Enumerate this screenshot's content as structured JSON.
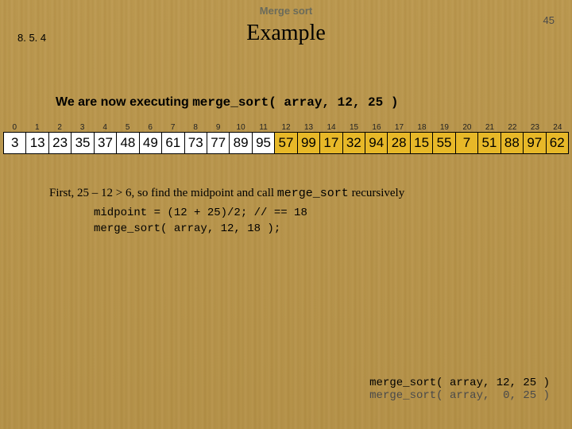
{
  "header": {
    "title": "Merge sort",
    "page_number": "45"
  },
  "section": {
    "number": "8. 5. 4",
    "title": "Example"
  },
  "intro": {
    "prefix": "We are now executing ",
    "code": "merge_sort( array, 12, 25 )"
  },
  "array": {
    "indices": [
      "0",
      "1",
      "2",
      "3",
      "4",
      "5",
      "6",
      "7",
      "8",
      "9",
      "10",
      "11",
      "12",
      "13",
      "14",
      "15",
      "16",
      "17",
      "18",
      "19",
      "20",
      "21",
      "22",
      "23",
      "24"
    ],
    "values": [
      "3",
      "13",
      "23",
      "35",
      "37",
      "48",
      "49",
      "61",
      "73",
      "77",
      "89",
      "95",
      "57",
      "99",
      "17",
      "32",
      "94",
      "28",
      "15",
      "55",
      "7",
      "51",
      "88",
      "97",
      "62"
    ],
    "highlight_start": 12,
    "highlight_end": 24
  },
  "explain": {
    "prefix": "First, ",
    "math": "25 – 12 > 6",
    "suffix": ", so find the midpoint and call ",
    "fn": "merge_sort",
    "tail": " recursively"
  },
  "code_block": "midpoint = (12 + 25)/2; // == 18\nmerge_sort( array, 12, 18 );",
  "stack": {
    "active": "merge_sort( array, 12, 25 )",
    "inactive": "merge_sort( array,  0, 25 )"
  }
}
